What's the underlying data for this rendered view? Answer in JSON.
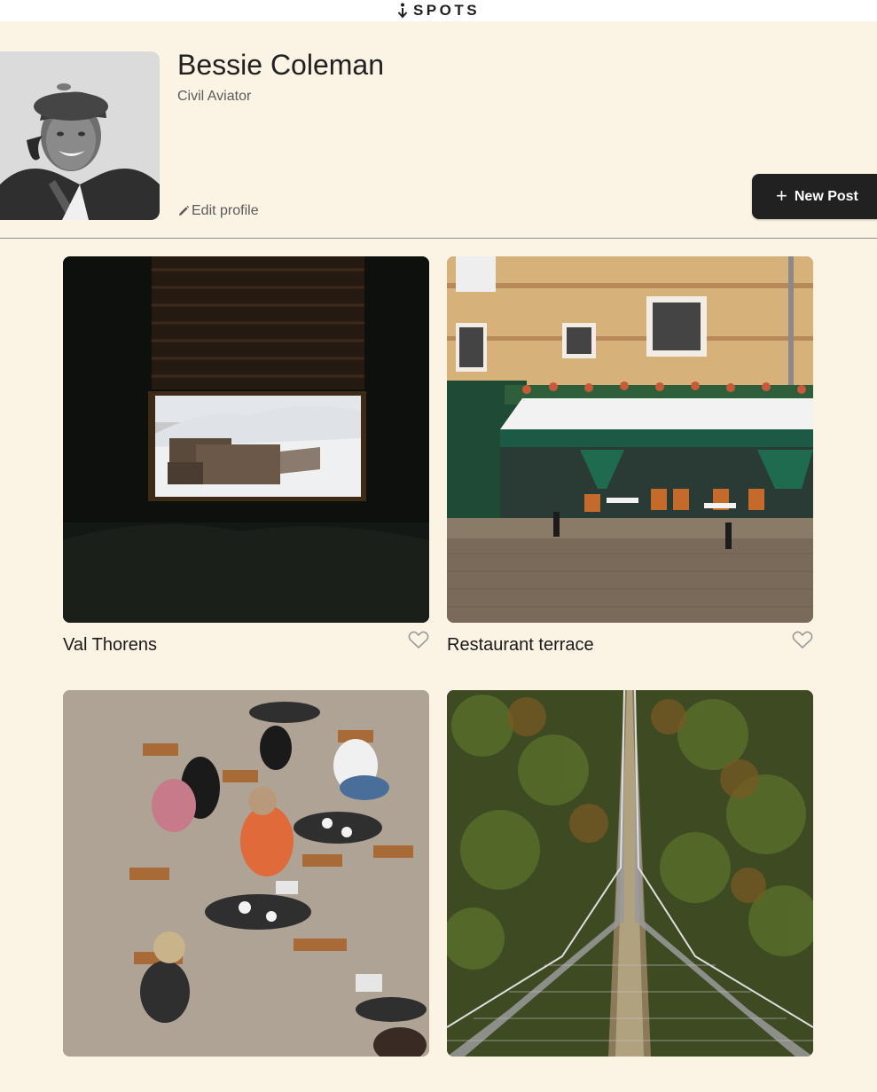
{
  "header": {
    "logo_text": "SPOTS"
  },
  "profile": {
    "name": "Bessie Coleman",
    "description": "Civil Aviator",
    "edit_label": "Edit profile",
    "new_post_label": "New Post",
    "new_post_icon": "plus-icon"
  },
  "cards": [
    {
      "title": "Val Thorens",
      "liked": false
    },
    {
      "title": "Restaurant terrace",
      "liked": false
    },
    {
      "title": "",
      "liked": false
    },
    {
      "title": "",
      "liked": false
    }
  ],
  "colors": {
    "page_bg": "#fbf3e4",
    "dark": "#212121",
    "secondary_text": "#5b5b5b"
  }
}
